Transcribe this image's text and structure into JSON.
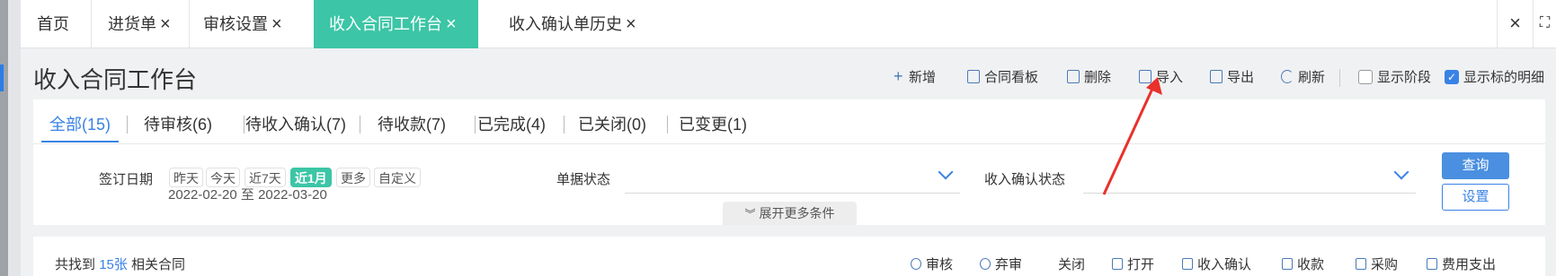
{
  "tabs": [
    {
      "label": "首页",
      "closable": false
    },
    {
      "label": "进货单",
      "closable": true
    },
    {
      "label": "审核设置",
      "closable": true
    },
    {
      "label": "收入合同工作台",
      "closable": true,
      "active": true
    },
    {
      "label": "收入确认单历史",
      "closable": true
    }
  ],
  "tab_close_icon": "×",
  "window_controls": {
    "close_all": "×",
    "fullscreen": "⛶"
  },
  "page": {
    "title": "收入合同工作台"
  },
  "toolbar": {
    "new": "新增",
    "board": "合同看板",
    "delete": "删除",
    "import": "导入",
    "export": "导出",
    "refresh": "刷新",
    "show_stage": "显示阶段",
    "show_detail": "显示标的明细"
  },
  "status_tabs": [
    {
      "label": "全部(15)",
      "active": true
    },
    {
      "label": "待审核(6)"
    },
    {
      "label": "待收入确认(7)"
    },
    {
      "label": "待收款(7)"
    },
    {
      "label": "已完成(4)"
    },
    {
      "label": "已关闭(0)"
    },
    {
      "label": "已变更(1)"
    }
  ],
  "filters": {
    "sign_date_label": "签订日期",
    "quick_dates": [
      "昨天",
      "今天",
      "近7天",
      "近1月",
      "更多",
      "自定义"
    ],
    "active_quick_date": "近1月",
    "date_range": "2022-02-20 至 2022-03-20",
    "doc_status_label": "单据状态",
    "doc_status_value": "",
    "income_confirm_label": "收入确认状态",
    "income_confirm_value": "",
    "query_button": "查询",
    "settings_button": "设置",
    "more_toggle": "展开更多条件"
  },
  "result": {
    "prefix": "共找到",
    "count": "15张",
    "suffix": "相关合同"
  },
  "actions": [
    "审核",
    "弃审",
    "关闭",
    "打开",
    "收入确认",
    "收款",
    "采购",
    "费用支出"
  ],
  "colors": {
    "accent": "#3cc5a6",
    "primary": "#3a82e6",
    "annotation": "#e8312a"
  }
}
